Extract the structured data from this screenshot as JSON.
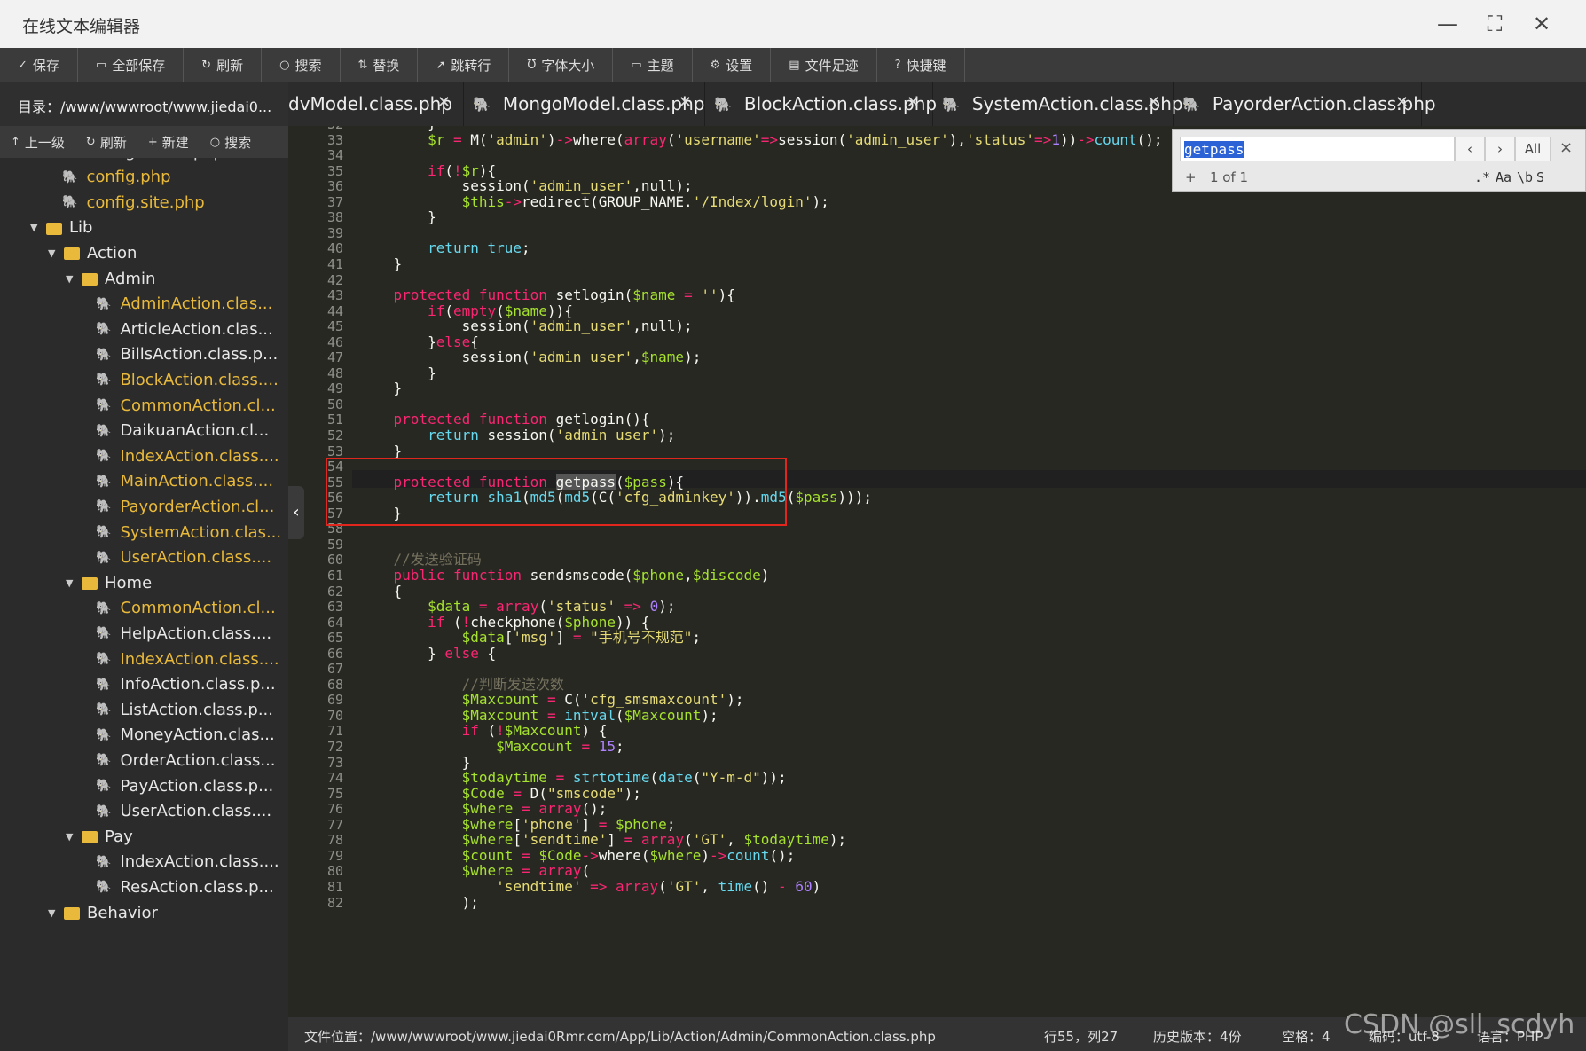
{
  "window": {
    "title": "在线文本编辑器",
    "min": "—",
    "max": "⛶",
    "close": "✕"
  },
  "toolbar": [
    {
      "icon": "✓",
      "label": "保存",
      "name": "save"
    },
    {
      "icon": "▭",
      "label": "全部保存",
      "name": "save-all"
    },
    {
      "icon": "↻",
      "label": "刷新",
      "name": "refresh"
    },
    {
      "icon": "○",
      "label": "搜索",
      "name": "search"
    },
    {
      "icon": "⇅",
      "label": "替换",
      "name": "replace"
    },
    {
      "icon": "➚",
      "label": "跳转行",
      "name": "goto-line"
    },
    {
      "icon": "Ʊ",
      "label": "字体大小",
      "name": "font-size"
    },
    {
      "icon": "▭",
      "label": "主题",
      "name": "theme"
    },
    {
      "icon": "⚙",
      "label": "设置",
      "name": "settings"
    },
    {
      "icon": "▤",
      "label": "文件足迹",
      "name": "file-history"
    },
    {
      "icon": "?",
      "label": "快捷键",
      "name": "shortcuts"
    }
  ],
  "path": "目录：/www/wwwroot/www.jiedai0...",
  "tabs": [
    {
      "label": "dvModel.class.php",
      "close": "✕"
    },
    {
      "label": "MongoModel.class.php",
      "close": "✕"
    },
    {
      "label": "BlockAction.class.php",
      "close": "✕"
    },
    {
      "label": "SystemAction.class.php",
      "close": "✕"
    },
    {
      "label": "PayorderAction.class.php",
      "close": "✕"
    }
  ],
  "sidetools": [
    {
      "icon": "↑",
      "label": "上一级",
      "name": "up"
    },
    {
      "icon": "↻",
      "label": "刷新",
      "name": "refresh"
    },
    {
      "icon": "+",
      "label": "新建",
      "name": "new"
    },
    {
      "icon": "○",
      "label": "搜索",
      "name": "search"
    }
  ],
  "tree": [
    {
      "label": "config.install.php",
      "type": "file",
      "depth": 1,
      "color": "#d8d8d8"
    },
    {
      "label": "config.php",
      "type": "file",
      "depth": 1,
      "color": "#e8b93a"
    },
    {
      "label": "config.site.php",
      "type": "file",
      "depth": 1,
      "color": "#e8b93a"
    },
    {
      "label": "Lib",
      "type": "folder",
      "depth": 0,
      "color": "#e8e8e8"
    },
    {
      "label": "Action",
      "type": "folder",
      "depth": 1,
      "color": "#e8e8e8"
    },
    {
      "label": "Admin",
      "type": "folder",
      "depth": 2,
      "color": "#e8e8e8"
    },
    {
      "label": "AdminAction.clas...",
      "type": "file",
      "depth": 3,
      "color": "#e8b93a"
    },
    {
      "label": "ArticleAction.clas...",
      "type": "file",
      "depth": 3,
      "color": "#e8e8e8"
    },
    {
      "label": "BillsAction.class.p...",
      "type": "file",
      "depth": 3,
      "color": "#e8e8e8"
    },
    {
      "label": "BlockAction.class....",
      "type": "file",
      "depth": 3,
      "color": "#e8b93a"
    },
    {
      "label": "CommonAction.cl...",
      "type": "file",
      "depth": 3,
      "color": "#e8b93a"
    },
    {
      "label": "DaikuanAction.cl...",
      "type": "file",
      "depth": 3,
      "color": "#e8e8e8"
    },
    {
      "label": "IndexAction.class....",
      "type": "file",
      "depth": 3,
      "color": "#e8b93a"
    },
    {
      "label": "MainAction.class....",
      "type": "file",
      "depth": 3,
      "color": "#e8b93a"
    },
    {
      "label": "PayorderAction.cl...",
      "type": "file",
      "depth": 3,
      "color": "#e8b93a"
    },
    {
      "label": "SystemAction.clas...",
      "type": "file",
      "depth": 3,
      "color": "#e8b93a"
    },
    {
      "label": "UserAction.class....",
      "type": "file",
      "depth": 3,
      "color": "#e8b93a"
    },
    {
      "label": "Home",
      "type": "folder",
      "depth": 2,
      "color": "#e8e8e8"
    },
    {
      "label": "CommonAction.cl...",
      "type": "file",
      "depth": 3,
      "color": "#e8b93a"
    },
    {
      "label": "HelpAction.class....",
      "type": "file",
      "depth": 3,
      "color": "#e8e8e8"
    },
    {
      "label": "IndexAction.class....",
      "type": "file",
      "depth": 3,
      "color": "#e8b93a"
    },
    {
      "label": "InfoAction.class.p...",
      "type": "file",
      "depth": 3,
      "color": "#e8e8e8"
    },
    {
      "label": "ListAction.class.p...",
      "type": "file",
      "depth": 3,
      "color": "#e8e8e8"
    },
    {
      "label": "MoneyAction.clas...",
      "type": "file",
      "depth": 3,
      "color": "#e8e8e8"
    },
    {
      "label": "OrderAction.class...",
      "type": "file",
      "depth": 3,
      "color": "#e8e8e8"
    },
    {
      "label": "PayAction.class.p...",
      "type": "file",
      "depth": 3,
      "color": "#e8e8e8"
    },
    {
      "label": "UserAction.class....",
      "type": "file",
      "depth": 3,
      "color": "#e8e8e8"
    },
    {
      "label": "Pay",
      "type": "folder",
      "depth": 2,
      "color": "#e8e8e8"
    },
    {
      "label": "IndexAction.class....",
      "type": "file",
      "depth": 3,
      "color": "#e8e8e8"
    },
    {
      "label": "ResAction.class.p...",
      "type": "file",
      "depth": 3,
      "color": "#e8e8e8"
    },
    {
      "label": "Behavior",
      "type": "folder",
      "depth": 1,
      "color": "#e8e8e8"
    }
  ],
  "code": [
    {
      "n": "32",
      "t": "        }"
    },
    {
      "n": "33",
      "t": "        $r = M('admin')->where(array('username'=>session('admin_user'),'status'=>1))->count();"
    },
    {
      "n": "34",
      "t": ""
    },
    {
      "n": "35",
      "t": "        if(!$r){"
    },
    {
      "n": "36",
      "t": "            session('admin_user',null);"
    },
    {
      "n": "37",
      "t": "            $this->redirect(GROUP_NAME.'/Index/login');"
    },
    {
      "n": "38",
      "t": "        }"
    },
    {
      "n": "39",
      "t": ""
    },
    {
      "n": "40",
      "t": "        return true;"
    },
    {
      "n": "41",
      "t": "    }"
    },
    {
      "n": "42",
      "t": ""
    },
    {
      "n": "43",
      "t": "    protected function setlogin($name = ''){"
    },
    {
      "n": "44",
      "t": "        if(empty($name)){"
    },
    {
      "n": "45",
      "t": "            session('admin_user',null);"
    },
    {
      "n": "46",
      "t": "        }else{"
    },
    {
      "n": "47",
      "t": "            session('admin_user',$name);"
    },
    {
      "n": "48",
      "t": "        }"
    },
    {
      "n": "49",
      "t": "    }"
    },
    {
      "n": "50",
      "t": ""
    },
    {
      "n": "51",
      "t": "    protected function getlogin(){"
    },
    {
      "n": "52",
      "t": "        return session('admin_user');"
    },
    {
      "n": "53",
      "t": "    }"
    },
    {
      "n": "54",
      "t": ""
    },
    {
      "n": "55",
      "t": "    protected function getpass($pass){"
    },
    {
      "n": "56",
      "t": "        return sha1(md5(md5(C('cfg_adminkey')).md5($pass)));"
    },
    {
      "n": "57",
      "t": "    }"
    },
    {
      "n": "58",
      "t": ""
    },
    {
      "n": "59",
      "t": ""
    },
    {
      "n": "60",
      "t": "    //发送验证码"
    },
    {
      "n": "61",
      "t": "    public function sendsmscode($phone,$discode)"
    },
    {
      "n": "62",
      "t": "    {"
    },
    {
      "n": "63",
      "t": "        $data = array('status' => 0);"
    },
    {
      "n": "64",
      "t": "        if (!checkphone($phone)) {"
    },
    {
      "n": "65",
      "t": "            $data['msg'] = \"手机号不规范\";"
    },
    {
      "n": "66",
      "t": "        } else {"
    },
    {
      "n": "67",
      "t": ""
    },
    {
      "n": "68",
      "t": "            //判断发送次数"
    },
    {
      "n": "69",
      "t": "            $Maxcount = C('cfg_smsmaxcount');"
    },
    {
      "n": "70",
      "t": "            $Maxcount = intval($Maxcount);"
    },
    {
      "n": "71",
      "t": "            if (!$Maxcount) {"
    },
    {
      "n": "72",
      "t": "                $Maxcount = 15;"
    },
    {
      "n": "73",
      "t": "            }"
    },
    {
      "n": "74",
      "t": "            $todaytime = strtotime(date(\"Y-m-d\"));"
    },
    {
      "n": "75",
      "t": "            $Code = D(\"smscode\");"
    },
    {
      "n": "76",
      "t": "            $where = array();"
    },
    {
      "n": "77",
      "t": "            $where['phone'] = $phone;"
    },
    {
      "n": "78",
      "t": "            $where['sendtime'] = array('GT', $todaytime);"
    },
    {
      "n": "79",
      "t": "            $count = $Code->where($where)->count();"
    },
    {
      "n": "80",
      "t": "            $where = array("
    },
    {
      "n": "81",
      "t": "                'sendtime' => array('GT', time() - 60)"
    },
    {
      "n": "82",
      "t": "            );"
    }
  ],
  "search": {
    "value": "getpass",
    "prev": "‹",
    "next": "›",
    "all": "All",
    "close": "×",
    "plus": "+",
    "count": "1 of 1",
    "regex": ".*",
    "case": "Aa",
    "word": "\\b",
    "sel": "S"
  },
  "status": {
    "location": "文件位置：/www/wwwroot/www.jiedai0Rmr.com/App/Lib/Action/Admin/CommonAction.class.php",
    "cursor": "行55，列27",
    "history": "历史版本：4份",
    "indent": "空格：4",
    "encoding": "编码：utf-8",
    "language": "语言：PHP"
  },
  "watermark": "CSDN @sll_scdyh",
  "colors": {
    "bg": "#272822",
    "keyword": "#f92672",
    "string": "#e6db74",
    "variable": "#a6e22e",
    "number": "#ae81ff",
    "comment": "#75715e",
    "func": "#66d9ef"
  }
}
